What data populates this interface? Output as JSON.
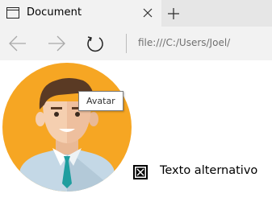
{
  "tab": {
    "title": "Document",
    "icon": "window-icon"
  },
  "address_bar": {
    "url": "file:///C:/Users/Joel/"
  },
  "image": {
    "tooltip": "Avatar",
    "alt_text": "Texto alternativo",
    "broken_icon": "broken-image-icon"
  },
  "colors": {
    "avatar_bg": "#f6a623",
    "skin": "#f5cfb0",
    "hair": "#5a3a24",
    "shirt": "#c4d8e6",
    "tie": "#1f9e9f"
  }
}
